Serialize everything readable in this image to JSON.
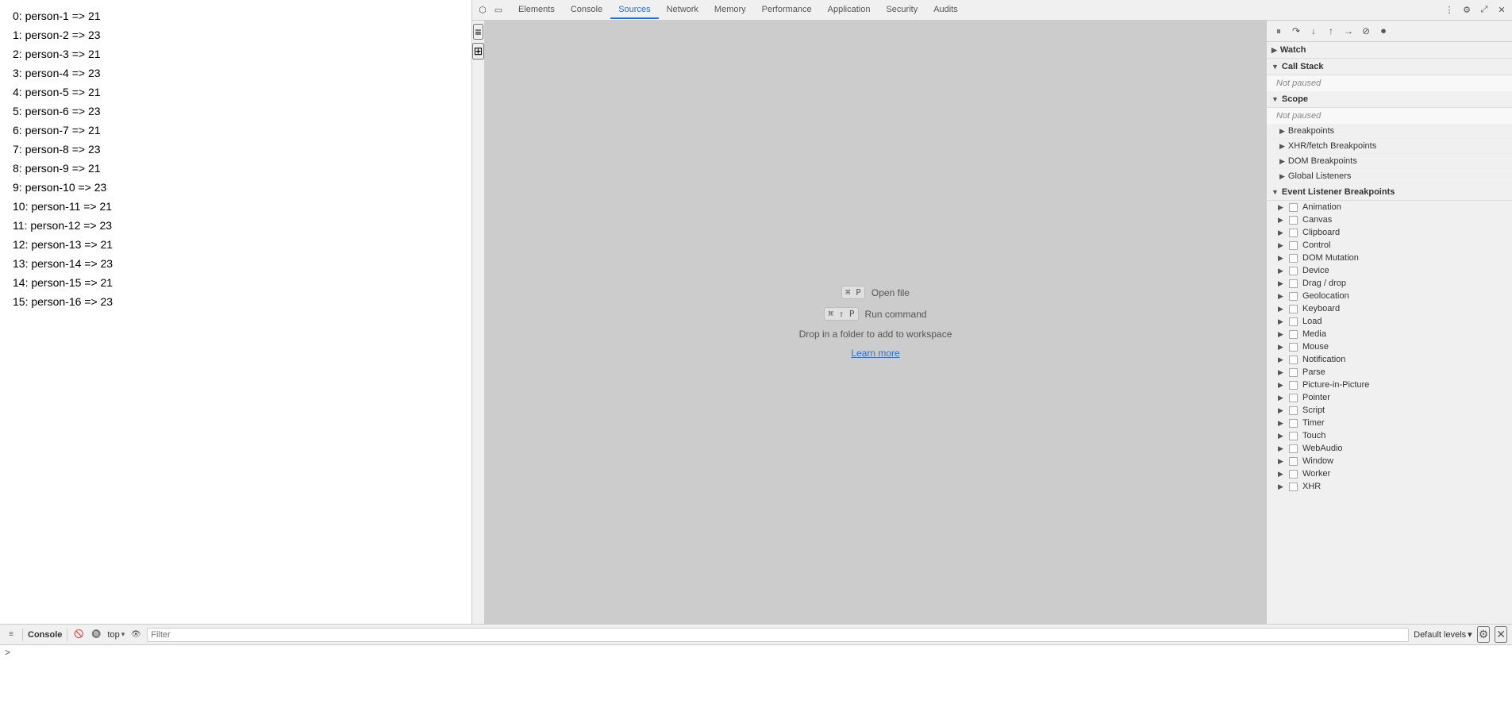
{
  "page": {
    "list_items": [
      "0: person-1 => 21",
      "1: person-2 => 23",
      "2: person-3 => 21",
      "3: person-4 => 23",
      "4: person-5 => 21",
      "5: person-6 => 23",
      "6: person-7 => 21",
      "7: person-8 => 23",
      "8: person-9 => 21",
      "9: person-10 => 23",
      "10: person-11 => 21",
      "11: person-12 => 23",
      "12: person-13 => 21",
      "13: person-14 => 23",
      "14: person-15 => 21",
      "15: person-16 => 23"
    ]
  },
  "devtools": {
    "tabs": [
      {
        "label": "Elements",
        "active": false
      },
      {
        "label": "Console",
        "active": false
      },
      {
        "label": "Sources",
        "active": true
      },
      {
        "label": "Network",
        "active": false
      },
      {
        "label": "Memory",
        "active": false
      },
      {
        "label": "Performance",
        "active": false
      },
      {
        "label": "Application",
        "active": false
      },
      {
        "label": "Security",
        "active": false
      },
      {
        "label": "Audits",
        "active": false
      }
    ],
    "sources": {
      "open_file_shortcut": "⌘ P",
      "open_file_label": "Open file",
      "run_command_shortcut": "⌘ ⇧ P",
      "run_command_label": "Run command",
      "drop_hint": "Drop in a folder to add to workspace",
      "learn_more": "Learn more"
    },
    "debugger": {
      "watch_label": "Watch",
      "call_stack_label": "Call Stack",
      "call_stack_status": "Not paused",
      "scope_label": "Scope",
      "scope_status": "Not paused",
      "breakpoints_label": "Breakpoints",
      "xhr_breakpoints_label": "XHR/fetch Breakpoints",
      "dom_breakpoints_label": "DOM Breakpoints",
      "global_listeners_label": "Global Listeners",
      "event_listener_label": "Event Listener Breakpoints",
      "event_listeners": [
        "Animation",
        "Canvas",
        "Clipboard",
        "Control",
        "DOM Mutation",
        "Device",
        "Drag / drop",
        "Geolocation",
        "Keyboard",
        "Load",
        "Media",
        "Mouse",
        "Notification",
        "Parse",
        "Picture-in-Picture",
        "Pointer",
        "Script",
        "Timer",
        "Touch",
        "WebAudio",
        "Window",
        "Worker",
        "XHR"
      ]
    }
  },
  "console": {
    "label": "Console",
    "top_label": "top",
    "filter_placeholder": "Filter",
    "levels_label": "Default levels",
    "levels_arrow": "▾",
    "eye_icon": "👁",
    "settings_icon": "⚙",
    "close_icon": "✕",
    "prompt_arrow": ">"
  }
}
